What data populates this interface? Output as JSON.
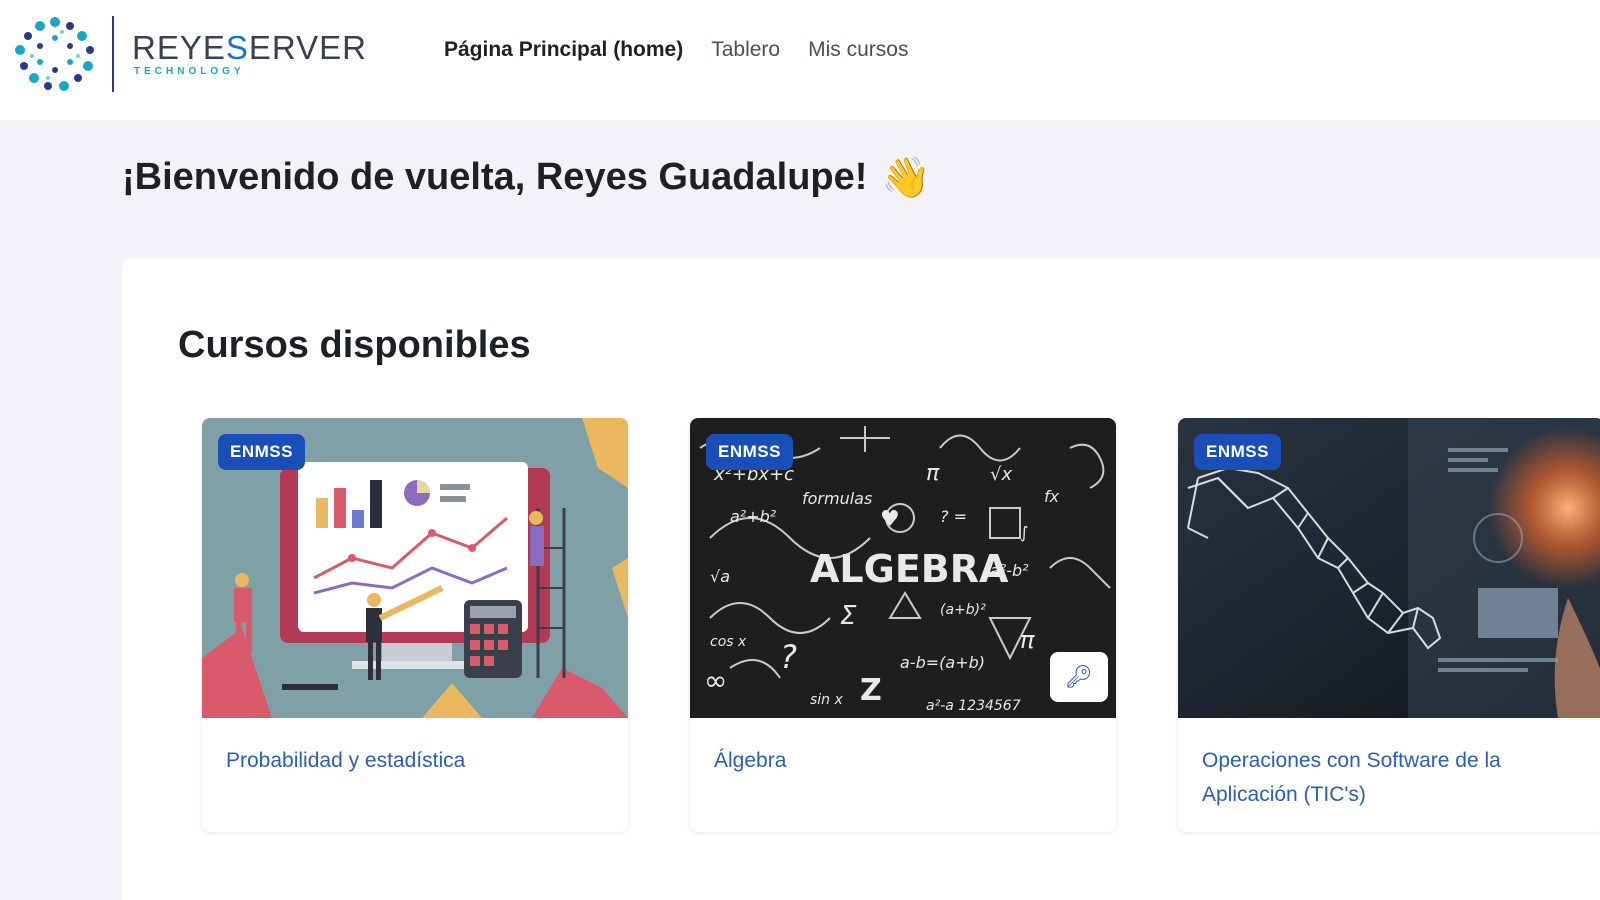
{
  "brand": {
    "name_pre": "REYE",
    "name_accent": "S",
    "name_post": "ERVER",
    "subtitle": "TECHNOLOGY"
  },
  "nav": {
    "items": [
      {
        "label": "Página Principal (home)",
        "active": true
      },
      {
        "label": "Tablero",
        "active": false
      },
      {
        "label": "Mis cursos",
        "active": false
      }
    ]
  },
  "welcome": {
    "text": "¡Bienvenido de vuelta, Reyes Guadalupe!",
    "emoji": "👋"
  },
  "courses": {
    "title": "Cursos disponibles",
    "items": [
      {
        "category": "ENMSS",
        "name": "Probabilidad y estadística",
        "image": "statistics-illustration"
      },
      {
        "category": "ENMSS",
        "name": "Álgebra",
        "image": "algebra-chalkboard",
        "key_icon": "key-icon"
      },
      {
        "category": "ENMSS",
        "name": "Operaciones con Software de la Aplicación (TIC's)",
        "image": "tech-map-photo"
      }
    ]
  }
}
